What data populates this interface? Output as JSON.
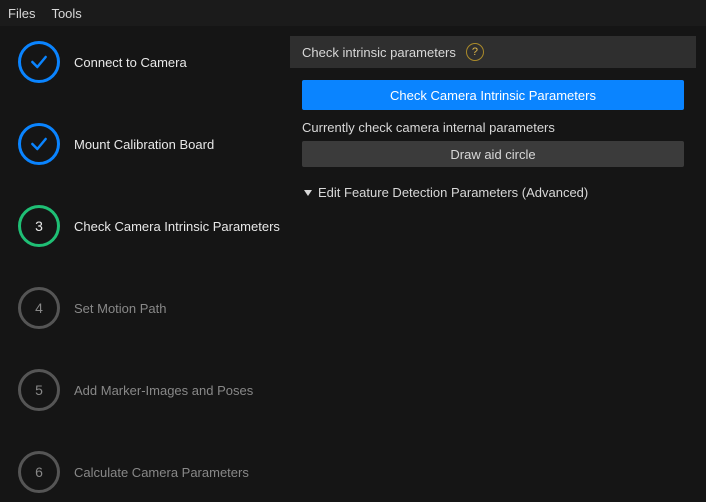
{
  "menubar": {
    "files": "Files",
    "tools": "Tools"
  },
  "sidebar": {
    "steps": [
      {
        "label": "Connect to Camera",
        "num": ""
      },
      {
        "label": "Mount Calibration Board",
        "num": ""
      },
      {
        "label": "Check Camera Intrinsic Parameters",
        "num": "3"
      },
      {
        "label": "Set Motion Path",
        "num": "4"
      },
      {
        "label": "Add Marker-Images and Poses",
        "num": "5"
      },
      {
        "label": "Calculate Camera Parameters",
        "num": "6"
      }
    ]
  },
  "panel": {
    "header": "Check intrinsic parameters",
    "help_glyph": "?",
    "primary_button": "Check Camera Intrinsic Parameters",
    "subtext": "Currently check camera internal parameters",
    "secondary_button": "Draw aid circle",
    "expander": "Edit Feature Detection Parameters (Advanced)"
  }
}
